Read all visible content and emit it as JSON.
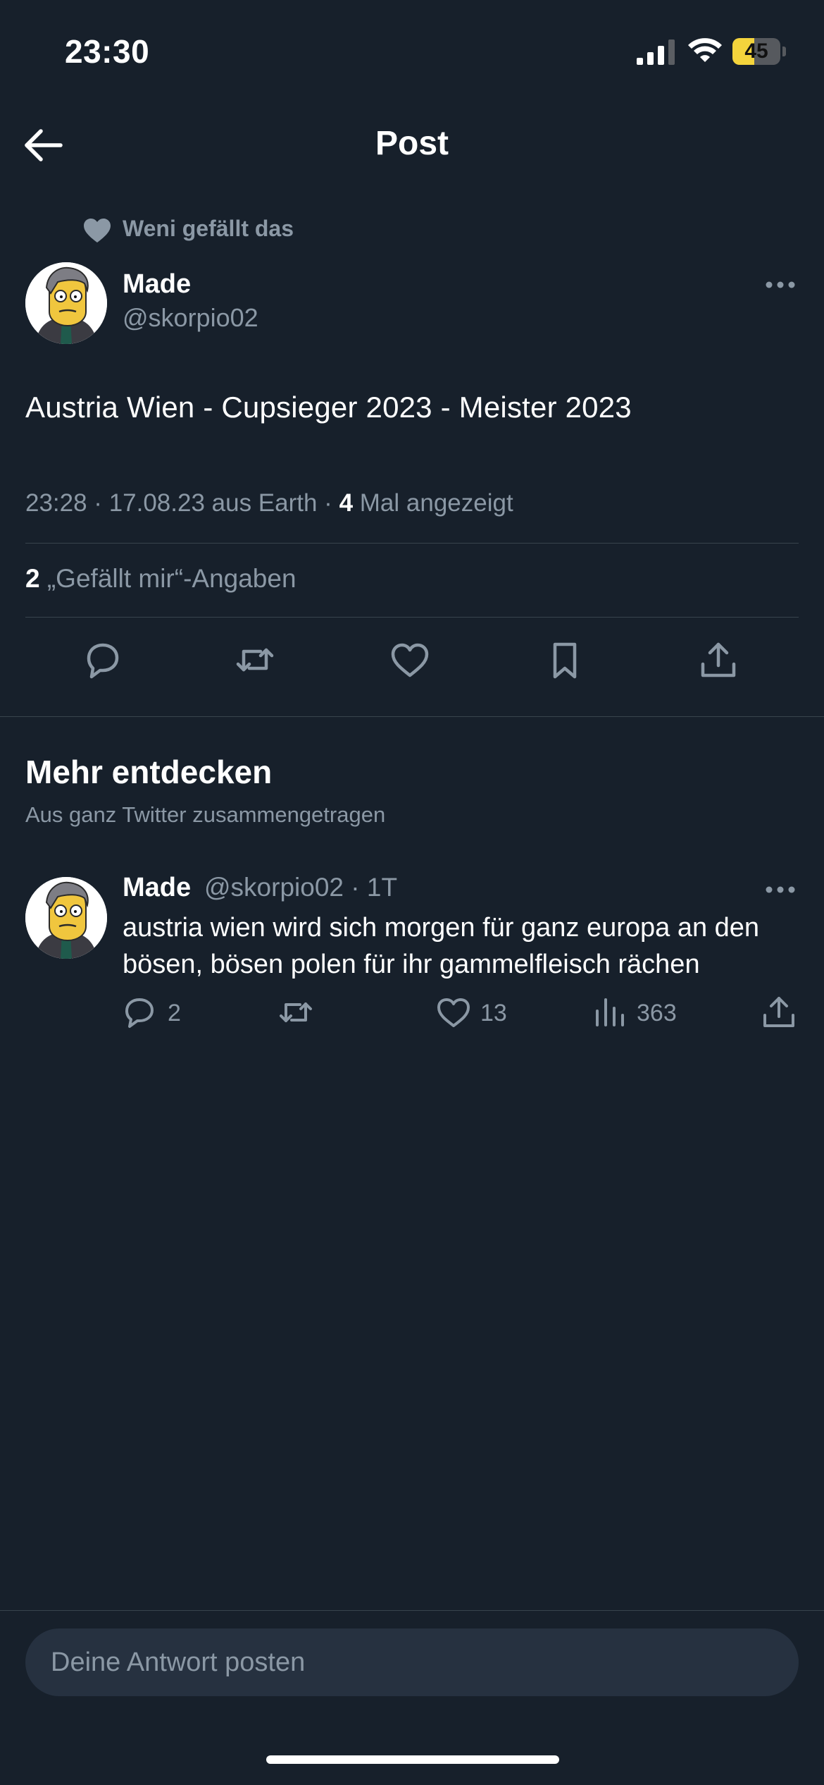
{
  "status_bar": {
    "time": "23:30",
    "battery_level": "45",
    "battery_fraction": 0.45
  },
  "header": {
    "title": "Post"
  },
  "social_context": {
    "text": "Weni gefällt das"
  },
  "post": {
    "author_name": "Made",
    "author_handle": "@skorpio02",
    "text": "Austria Wien - Cupsieger 2023 - Meister 2023",
    "timestamp": "23:28 · 17.08.23 aus Earth · ",
    "views_count": "4",
    "views_label": " Mal angezeigt",
    "likes_count": "2",
    "likes_label": " „Gefällt mir“-Angaben"
  },
  "discover": {
    "title": "Mehr entdecken",
    "subtitle": "Aus ganz Twitter zusammengetragen"
  },
  "discover_post": {
    "author_name": "Made",
    "meta": "@skorpio02 · 1T",
    "line1": "austria wien wird sich morgen für ganz europa an den",
    "line2": "bösen, bösen polen für ihr gammelfleisch rächen",
    "replies": "2",
    "likes": "13",
    "views": "363"
  },
  "reply": {
    "placeholder": "Deine Antwort posten"
  },
  "colors": {
    "background": "#17202b",
    "text_primary": "#ffffff",
    "text_secondary": "#8b98a5",
    "divider": "#38444d",
    "battery": "#f4d43c"
  },
  "icons": [
    "arrow-left-icon",
    "heart-icon",
    "more-icon",
    "reply-icon",
    "retweet-icon",
    "bookmark-icon",
    "share-icon",
    "views-icon"
  ]
}
